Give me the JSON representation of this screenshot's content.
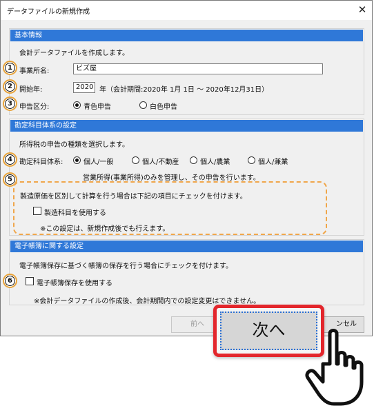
{
  "window": {
    "title": "データファイルの新規作成",
    "close_glyph": "✕"
  },
  "basic": {
    "header": "基本情報",
    "desc": "会計データファイルを作成します。",
    "office_label": "事業所名:",
    "office_value": "ビズ屋",
    "start_label": "開始年:",
    "start_year": "2020",
    "start_suffix": "年（会計期間:2020年 1月 1日 〜 2020年12月31日）",
    "filing_label": "申告区分:",
    "filing_options": [
      "青色申告",
      "白色申告"
    ],
    "filing_selected": "青色申告"
  },
  "accounts": {
    "header": "勘定科目体系の設定",
    "desc": "所得税の申告の種類を選択します。",
    "system_label": "勘定科目体系:",
    "options": [
      "個人/一般",
      "個人/不動産",
      "個人/農業",
      "個人/兼業"
    ],
    "selected": "個人/一般",
    "note": "営業所得(事業所得)のみを管理し、その申告を行います。",
    "mfg_desc": "製造原価を区別して計算を行う場合は下記の項目にチェックを付けます。",
    "mfg_check_label": "製造科目を使用する",
    "mfg_checked": false,
    "mfg_note": "※この設定は、新規作成後でも行えます。"
  },
  "ebook": {
    "header": "電子帳簿に関する設定",
    "desc": "電子帳簿保存に基づく帳簿の保存を行う場合にチェックを付けます。",
    "check_label": "電子帳簿保存を使用する",
    "checked": false,
    "note": "※会計データファイルの作成後、会計期間内での設定変更はできません。"
  },
  "buttons": {
    "prev": "前へ",
    "next": "次へ",
    "cancel_partial": "ンセル"
  },
  "markers": [
    "1",
    "2",
    "3",
    "4",
    "5",
    "6"
  ],
  "colors": {
    "header_blue": "#2f78d8",
    "highlight_red": "#e3262c",
    "marker_orange": "#e8a33a"
  },
  "icons": {
    "cursor": "pointing-hand-icon"
  }
}
